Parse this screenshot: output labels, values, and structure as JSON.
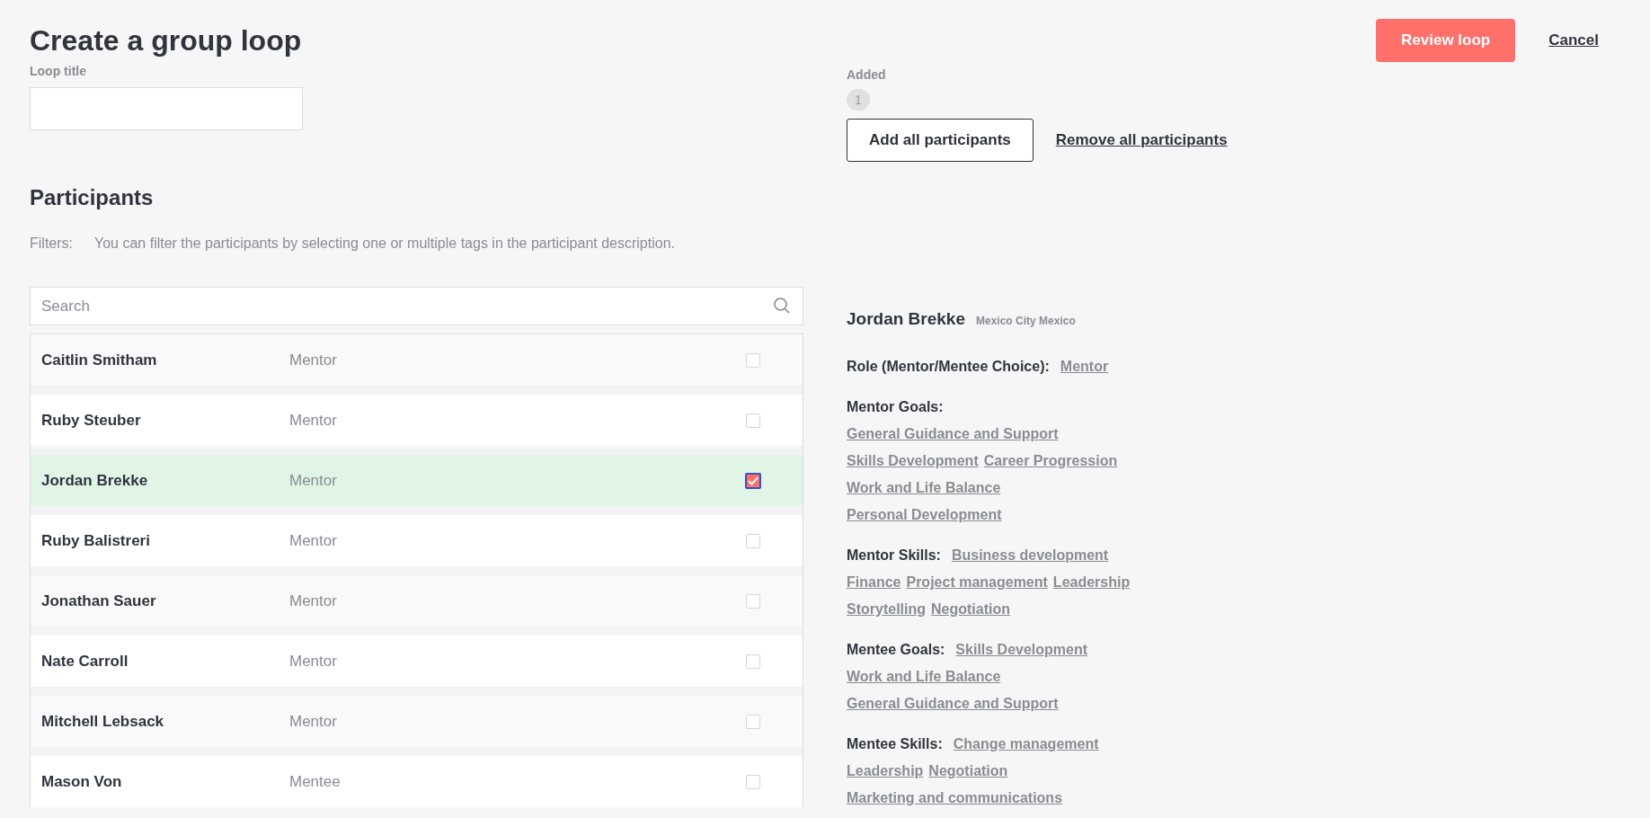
{
  "page": {
    "title": "Create a group loop"
  },
  "actions": {
    "primary": "Review loop",
    "cancel": "Cancel"
  },
  "loop_title": {
    "label": "Loop title"
  },
  "added": {
    "label": "Added",
    "count": "1",
    "add_all": "Add all participants",
    "remove_all": "Remove all participants"
  },
  "participants": {
    "heading": "Participants",
    "filters_label": "Filters:",
    "filters_hint": "You can filter the participants by selecting one or multiple tags in the participant description.",
    "search": {
      "placeholder": "Search"
    },
    "rows": [
      {
        "name": "Caitlin Smitham",
        "role": "Mentor",
        "checked": false
      },
      {
        "name": "Ruby Steuber",
        "role": "Mentor",
        "checked": false
      },
      {
        "name": "Jordan Brekke",
        "role": "Mentor",
        "checked": true
      },
      {
        "name": "Ruby Balistreri",
        "role": "Mentor",
        "checked": false
      },
      {
        "name": "Jonathan Sauer",
        "role": "Mentor",
        "checked": false
      },
      {
        "name": "Nate Carroll",
        "role": "Mentor",
        "checked": false
      },
      {
        "name": "Mitchell Lebsack",
        "role": "Mentor",
        "checked": false
      },
      {
        "name": "Mason Von",
        "role": "Mentee",
        "checked": false
      }
    ]
  },
  "detail": {
    "name": "Jordan Brekke",
    "location": "Mexico City Mexico",
    "sections": [
      {
        "label": "Role (Mentor/Mentee Choice):",
        "tags": [
          "Mentor"
        ]
      },
      {
        "label": "Mentor Goals:",
        "tags": [
          "General Guidance and Support",
          "Skills Development",
          "Career Progression",
          "Work and Life Balance",
          "Personal Development"
        ]
      },
      {
        "label": "Mentor Skills:",
        "tags": [
          "Business development",
          "Finance",
          "Project management",
          "Leadership",
          "Storytelling",
          "Negotiation"
        ]
      },
      {
        "label": "Mentee Goals:",
        "tags": [
          "Skills Development",
          "Work and Life Balance",
          "General Guidance and Support"
        ]
      },
      {
        "label": "Mentee Skills:",
        "tags": [
          "Change management",
          "Leadership",
          "Negotiation",
          "Marketing and communications"
        ]
      }
    ]
  }
}
